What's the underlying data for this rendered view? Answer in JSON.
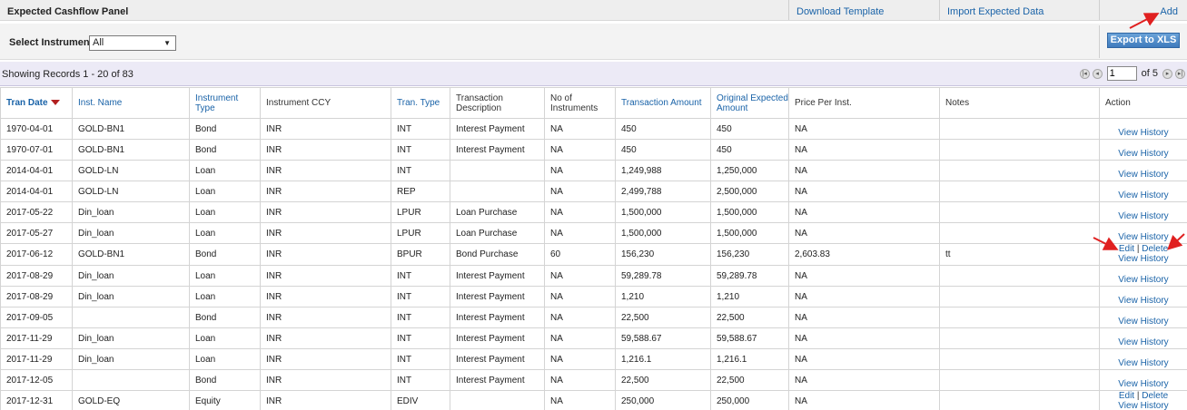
{
  "header": {
    "title": "Expected Cashflow Panel",
    "download_template": "Download Template",
    "import_expected": "Import Expected Data",
    "add": "Add"
  },
  "filter": {
    "label": "Select Instrument",
    "selected": "All",
    "export": "Export to XLS"
  },
  "pagination": {
    "info": "Showing Records 1 - 20 of 83",
    "page": "1",
    "of": "of 5"
  },
  "columns": [
    {
      "label": "Tran Date",
      "sortable": true,
      "sorted": "desc"
    },
    {
      "label": "Inst. Name",
      "sortable": true
    },
    {
      "label": "Instrument Type",
      "sortable": true
    },
    {
      "label": "Instrument CCY",
      "sortable": false
    },
    {
      "label": "Tran. Type",
      "sortable": true
    },
    {
      "label": "Transaction Description",
      "sortable": false
    },
    {
      "label": "No of Instruments",
      "sortable": false
    },
    {
      "label": "Transaction Amount",
      "sortable": true
    },
    {
      "label": "Original Expected Amount",
      "sortable": true
    },
    {
      "label": "Price Per Inst.",
      "sortable": false
    },
    {
      "label": "Notes",
      "sortable": false
    },
    {
      "label": "Action",
      "sortable": false
    }
  ],
  "actions": {
    "view_history": "View History",
    "edit": "Edit",
    "delete": "Delete",
    "sep": "|"
  },
  "rows": [
    {
      "date": "1970-04-01",
      "name": "GOLD-BN1",
      "type": "Bond",
      "ccy": "INR",
      "tran_type": "INT",
      "desc": "Interest Payment",
      "num": "NA",
      "amount": "450",
      "orig": "450",
      "price": "NA",
      "notes": "",
      "editable": false
    },
    {
      "date": "1970-07-01",
      "name": "GOLD-BN1",
      "type": "Bond",
      "ccy": "INR",
      "tran_type": "INT",
      "desc": "Interest Payment",
      "num": "NA",
      "amount": "450",
      "orig": "450",
      "price": "NA",
      "notes": "",
      "editable": false
    },
    {
      "date": "2014-04-01",
      "name": "GOLD-LN",
      "type": "Loan",
      "ccy": "INR",
      "tran_type": "INT",
      "desc": "",
      "num": "NA",
      "amount": "1,249,988",
      "orig": "1,250,000",
      "price": "NA",
      "notes": "",
      "editable": false
    },
    {
      "date": "2014-04-01",
      "name": "GOLD-LN",
      "type": "Loan",
      "ccy": "INR",
      "tran_type": "REP",
      "desc": "",
      "num": "NA",
      "amount": "2,499,788",
      "orig": "2,500,000",
      "price": "NA",
      "notes": "",
      "editable": false
    },
    {
      "date": "2017-05-22",
      "name": "Din_loan",
      "type": "Loan",
      "ccy": "INR",
      "tran_type": "LPUR",
      "desc": "Loan Purchase",
      "num": "NA",
      "amount": "1,500,000",
      "orig": "1,500,000",
      "price": "NA",
      "notes": "",
      "editable": false
    },
    {
      "date": "2017-05-27",
      "name": "Din_loan",
      "type": "Loan",
      "ccy": "INR",
      "tran_type": "LPUR",
      "desc": "Loan Purchase",
      "num": "NA",
      "amount": "1,500,000",
      "orig": "1,500,000",
      "price": "NA",
      "notes": "",
      "editable": false
    },
    {
      "date": "2017-06-12",
      "name": "GOLD-BN1",
      "type": "Bond",
      "ccy": "INR",
      "tran_type": "BPUR",
      "desc": "Bond Purchase",
      "num": "60",
      "amount": "156,230",
      "orig": "156,230",
      "price": "2,603.83",
      "notes": "tt",
      "editable": true
    },
    {
      "date": "2017-08-29",
      "name": "Din_loan",
      "type": "Loan",
      "ccy": "INR",
      "tran_type": "INT",
      "desc": "Interest Payment",
      "num": "NA",
      "amount": "59,289.78",
      "orig": "59,289.78",
      "price": "NA",
      "notes": "",
      "editable": false
    },
    {
      "date": "2017-08-29",
      "name": "Din_loan",
      "type": "Loan",
      "ccy": "INR",
      "tran_type": "INT",
      "desc": "Interest Payment",
      "num": "NA",
      "amount": "1,210",
      "orig": "1,210",
      "price": "NA",
      "notes": "",
      "editable": false
    },
    {
      "date": "2017-09-05",
      "name": "",
      "type": "Bond",
      "ccy": "INR",
      "tran_type": "INT",
      "desc": "Interest Payment",
      "num": "NA",
      "amount": "22,500",
      "orig": "22,500",
      "price": "NA",
      "notes": "",
      "editable": false
    },
    {
      "date": "2017-11-29",
      "name": "Din_loan",
      "type": "Loan",
      "ccy": "INR",
      "tran_type": "INT",
      "desc": "Interest Payment",
      "num": "NA",
      "amount": "59,588.67",
      "orig": "59,588.67",
      "price": "NA",
      "notes": "",
      "editable": false
    },
    {
      "date": "2017-11-29",
      "name": "Din_loan",
      "type": "Loan",
      "ccy": "INR",
      "tran_type": "INT",
      "desc": "Interest Payment",
      "num": "NA",
      "amount": "1,216.1",
      "orig": "1,216.1",
      "price": "NA",
      "notes": "",
      "editable": false
    },
    {
      "date": "2017-12-05",
      "name": "",
      "type": "Bond",
      "ccy": "INR",
      "tran_type": "INT",
      "desc": "Interest Payment",
      "num": "NA",
      "amount": "22,500",
      "orig": "22,500",
      "price": "NA",
      "notes": "",
      "editable": false
    },
    {
      "date": "2017-12-31",
      "name": "GOLD-EQ",
      "type": "Equity",
      "ccy": "INR",
      "tran_type": "EDIV",
      "desc": "",
      "num": "NA",
      "amount": "250,000",
      "orig": "250,000",
      "price": "NA",
      "notes": "",
      "editable": true
    }
  ],
  "colors": {
    "link": "#1a63a8",
    "sort_arrow": "#b22020",
    "annotation_arrow": "#e02020",
    "pager_bg": "#eceaf6",
    "export_button": "#4a86c6"
  }
}
